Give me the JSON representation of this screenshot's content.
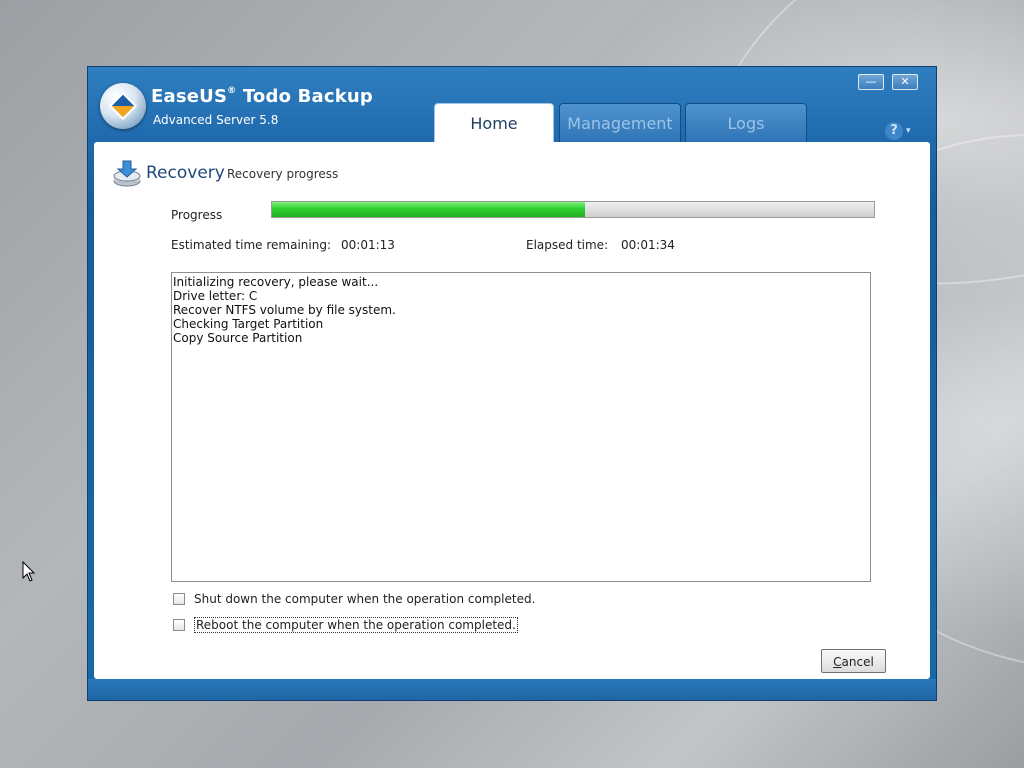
{
  "app": {
    "brand_part1": "EaseUS",
    "brand_reg": "®",
    "brand_part2": " Todo Backup",
    "edition": "Advanced Server 5.8"
  },
  "window_controls": {
    "minimize": "—",
    "close": "✕"
  },
  "tabs": [
    {
      "label": "Home",
      "active": true
    },
    {
      "label": "Management",
      "active": false
    },
    {
      "label": "Logs",
      "active": false
    }
  ],
  "help": {
    "glyph": "?",
    "arrow": "▾"
  },
  "recovery": {
    "title": "Recovery",
    "subtitle": "Recovery progress",
    "progress_label": "Progress",
    "progress_fraction": 0.52,
    "estimated_label": "Estimated time remaining:",
    "estimated_value": "00:01:13",
    "elapsed_label": "Elapsed time:",
    "elapsed_value": "00:01:34",
    "log_lines": [
      "Initializing recovery, please wait...",
      "Drive letter: C",
      "Recover NTFS volume by file system.",
      "Checking Target Partition",
      "Copy Source Partition"
    ],
    "shutdown_label": "Shut down the computer when the operation completed.",
    "reboot_label": "Reboot the computer when the operation completed.",
    "cancel_label": "Cancel"
  },
  "colors": {
    "title_bar": "#1f69ad",
    "progress_green": "#2fd02f",
    "accent_text": "#1f4a78"
  }
}
